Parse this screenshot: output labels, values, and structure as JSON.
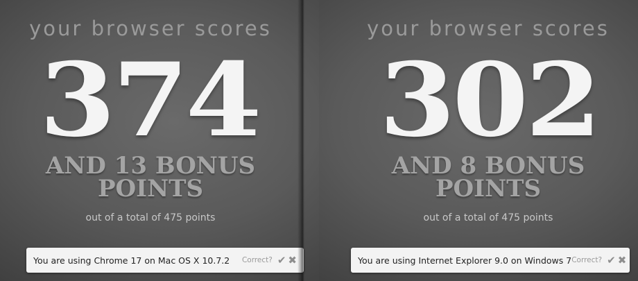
{
  "panels": [
    {
      "heading": "your browser scores",
      "score": "374",
      "bonus_line1": "AND 13 BONUS",
      "bonus_line2": "POINTS",
      "total": "out of a total of 475 points",
      "using": "You are using Chrome 17 on Mac OS X 10.7.2",
      "correct_label": "Correct?",
      "confirm_glyph": "✔",
      "reject_glyph": "✖"
    },
    {
      "heading": "your browser scores",
      "score": "302",
      "bonus_line1": "AND 8 BONUS",
      "bonus_line2": "POINTS",
      "total": "out of a total of 475 points",
      "using": "You are using Internet Explorer 9.0 on Windows 7",
      "correct_label": "Correct?",
      "confirm_glyph": "✔",
      "reject_glyph": "✖"
    }
  ],
  "colors": {
    "score": "#f4f4f4",
    "heading": "#9a9a9a",
    "bonus": "#a4a4a4",
    "bar_background": "#f3f3f3"
  }
}
